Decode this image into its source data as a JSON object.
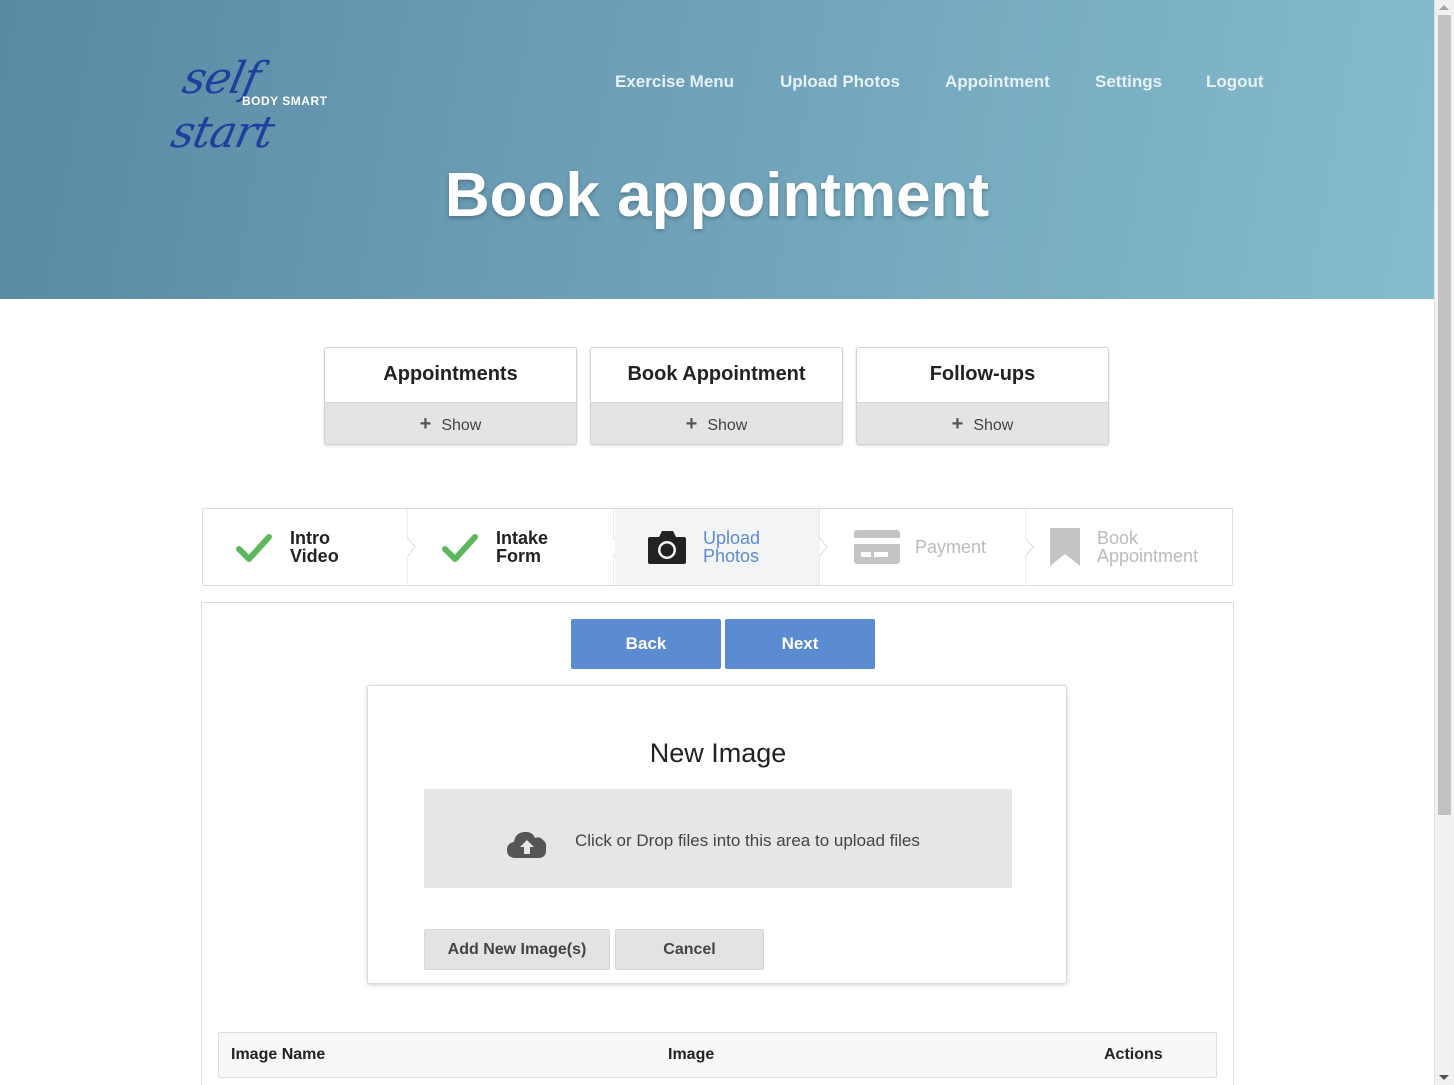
{
  "brand": {
    "script": "self start",
    "sub": "BODY SMART"
  },
  "nav": [
    "Exercise Menu",
    "Upload Photos",
    "Appointment",
    "Settings",
    "Logout"
  ],
  "page_title": "Book appointment",
  "cards": [
    {
      "title": "Appointments",
      "toggle": "Show"
    },
    {
      "title": "Book Appointment",
      "toggle": "Show"
    },
    {
      "title": "Follow-ups",
      "toggle": "Show"
    }
  ],
  "steps": [
    {
      "line1": "Intro",
      "line2": "Video",
      "icon": "check-icon",
      "state": "done"
    },
    {
      "line1": "Intake",
      "line2": "Form",
      "icon": "check-icon",
      "state": "done"
    },
    {
      "line1": "Upload",
      "line2": "Photos",
      "icon": "camera-icon",
      "state": "active"
    },
    {
      "line1": "Payment",
      "line2": "",
      "icon": "credit-card-icon",
      "state": "disabled"
    },
    {
      "line1": "Book",
      "line2": "Appointment",
      "icon": "bookmark-icon",
      "state": "disabled"
    }
  ],
  "buttons": {
    "back": "Back",
    "next": "Next"
  },
  "modal": {
    "title": "New Image",
    "dropzone": "Click or Drop files into this area to upload files",
    "add": "Add New Image(s)",
    "cancel": "Cancel"
  },
  "table": {
    "columns": [
      "Image Name",
      "Image",
      "Actions"
    ]
  },
  "colors": {
    "primary_button": "#5b8bd0",
    "check": "#5cb85c",
    "active_step_text": "#5b8bd0",
    "disabled_step": "#bbbbbb"
  }
}
